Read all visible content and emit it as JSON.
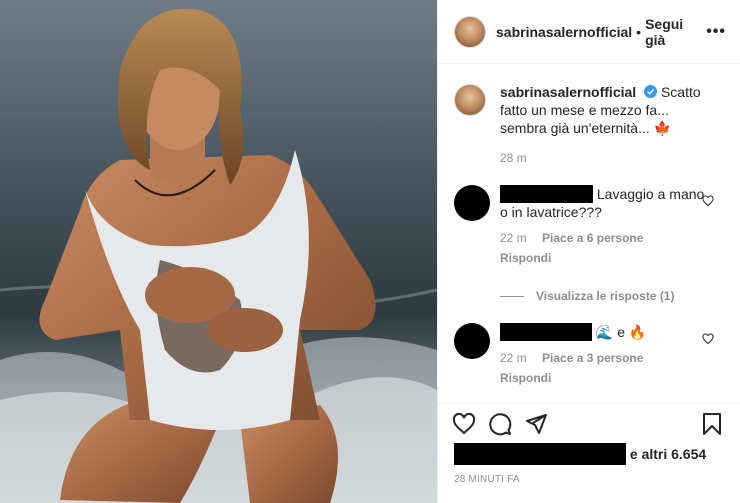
{
  "post": {
    "username": "sabrinasalernofficial",
    "separator": "•",
    "follow_label": "Segui già",
    "more_label": "•••",
    "caption_user": "sabrinasalernofficial",
    "caption_text": "Scatto fatto un mese e mezzo fa... sembra già un'eternità...",
    "caption_emoji": "🍁",
    "caption_time": "28 m"
  },
  "comments": [
    {
      "text": "Lavaggio a mano o in lavatrice???",
      "time": "22 m",
      "likes": "Piace a 6 persone",
      "reply": "Rispondi"
    },
    {
      "text_pre": "🌊 e ",
      "text_emoji": "🔥",
      "time": "22 m",
      "likes": "Piace a 3 persone",
      "reply": "Rispondi"
    },
    {
      "text": "🙌🙌🙌"
    }
  ],
  "view_replies": "Visualizza le risposte (1)",
  "likes": {
    "suffix": "e altri 6.654"
  },
  "posted_time": "28 MINUTI FA",
  "icons": [
    "heart-icon",
    "comment-icon",
    "share-icon",
    "bookmark-icon",
    "verified-badge-icon",
    "more-icon"
  ],
  "colors": {
    "verified": "#3897f0",
    "muted": "#8e8e8e",
    "text": "#262626"
  }
}
